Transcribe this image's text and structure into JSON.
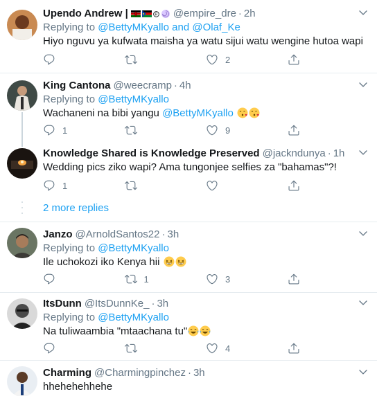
{
  "tweets": [
    {
      "name": "Upendo Andrew |",
      "handle": "@empire_dre",
      "time": "2h",
      "replying_label": "Replying to",
      "mentions": [
        "@BettyMKyallo",
        "and",
        "@Olaf_Ke"
      ],
      "text": "Hiyo nguvu ya kufwata maisha ya watu sijui watu wengine hutoa wapi",
      "reply_count": "",
      "retweet_count": "",
      "like_count": "2"
    },
    {
      "name": "King Cantona",
      "handle": "@weecramp",
      "time": "4h",
      "replying_label": "Replying to",
      "mentions": [
        "@BettyMKyallo"
      ],
      "text": "Wachaneni na bibi yangu",
      "text_mention": "@BettyMKyallo",
      "reply_count": "1",
      "retweet_count": "",
      "like_count": "9"
    },
    {
      "name": "Knowledge Shared is Knowledge Preserved",
      "handle": "@jackndunya",
      "time": "1h",
      "text": "Wedding pics ziko wapi? Ama tungonjee selfies za \"bahamas\"?!",
      "reply_count": "1",
      "retweet_count": "",
      "like_count": ""
    },
    {
      "name": "Janzo",
      "handle": "@ArnoldSantos22",
      "time": "3h",
      "replying_label": "Replying to",
      "mentions": [
        "@BettyMKyallo"
      ],
      "text": "Ile uchokozi iko Kenya hii",
      "reply_count": "",
      "retweet_count": "1",
      "like_count": "3"
    },
    {
      "name": "ItsDunn",
      "handle": "@ItsDunnKe_",
      "time": "3h",
      "replying_label": "Replying to",
      "mentions": [
        "@BettyMKyallo"
      ],
      "text": "Na tuliwaambia \"mtaachana tu\"",
      "reply_count": "",
      "retweet_count": "",
      "like_count": "4"
    },
    {
      "name": "Charming",
      "handle": "@Charmingpinchez",
      "time": "3h",
      "text": "hhehehehhehe"
    }
  ],
  "more_replies": "2 more replies",
  "dot": "·",
  "colors": {
    "link": "#1da1f2",
    "muted": "#657786",
    "divider": "#e6ecf0",
    "thread": "#ccd6dd"
  },
  "icons": [
    "reply-icon",
    "retweet-icon",
    "like-icon",
    "share-icon",
    "chevron-down-icon",
    "emoji-kissing-heart-icon",
    "emoji-laughing-icon",
    "emoji-tears-of-joy-icon"
  ]
}
